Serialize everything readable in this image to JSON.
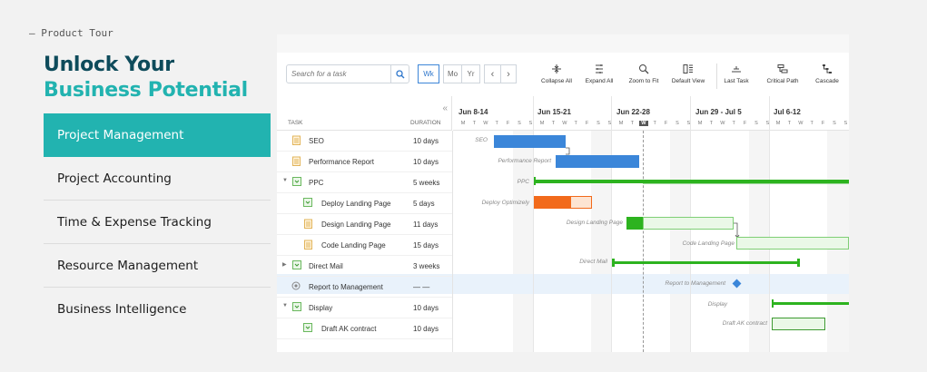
{
  "hero": {
    "eyebrow": "— Product Tour",
    "title_line1": "Unlock Your",
    "title_line2": "Business Potential"
  },
  "menu": {
    "items": [
      {
        "label": "Project Management",
        "active": true
      },
      {
        "label": "Project Accounting",
        "active": false
      },
      {
        "label": "Time & Expense Tracking",
        "active": false
      },
      {
        "label": "Resource Management",
        "active": false
      },
      {
        "label": "Business Intelligence",
        "active": false
      }
    ]
  },
  "toolbar": {
    "search_placeholder": "Search for a task",
    "view_wk": "Wk",
    "view_mo": "Mo",
    "view_yr": "Yr",
    "prev": "‹",
    "next": "›",
    "collapse_all": "Collapse All",
    "expand_all": "Expand All",
    "zoom_to_fit": "Zoom to Fit",
    "default_view": "Default View",
    "last_task": "Last Task",
    "critical_path": "Critical Path",
    "cascade": "Cascade"
  },
  "grid": {
    "col_task": "TASK",
    "col_duration": "DURATION",
    "collapse_chevron": "«",
    "rows": [
      {
        "name": "SEO",
        "duration": "10 days"
      },
      {
        "name": "Performance Report",
        "duration": "10 days"
      },
      {
        "name": "PPC",
        "duration": "5 weeks"
      },
      {
        "name": "Deploy Landing Page",
        "duration": "5 days"
      },
      {
        "name": "Design Landing Page",
        "duration": "11 days"
      },
      {
        "name": "Code Landing Page",
        "duration": "15 days"
      },
      {
        "name": "Direct Mail",
        "duration": "3 weeks"
      },
      {
        "name": "Report to Management",
        "duration": "— —"
      },
      {
        "name": "Display",
        "duration": "10 days"
      },
      {
        "name": "Draft AK contract",
        "duration": "10 days"
      }
    ]
  },
  "timeline": {
    "weeks": [
      "Jun 8-14",
      "Jun 15-21",
      "Jun 22-28",
      "Jun 29 - Jul 5",
      "Jul 6-12"
    ],
    "day_letters": [
      "M",
      "T",
      "W",
      "T",
      "F",
      "S",
      "S"
    ],
    "today_letter": "W",
    "bar_labels": {
      "seo": "SEO",
      "performance_report": "Performance Report",
      "ppc": "PPC",
      "deploy": "Deploy Optimizely",
      "design": "Design Landing Page",
      "code": "Code Landing Page",
      "direct_mail": "Direct Mail",
      "report": "Report to Management",
      "display": "Display",
      "draft": "Draft AK contract"
    }
  },
  "colors": {
    "teal": "#22b3b0",
    "navy": "#0e4b5b",
    "blue_bar": "#3b86d9",
    "green_bar": "#2db31f",
    "orange_bar": "#f26a1b",
    "milestone": "#3b86d9"
  }
}
